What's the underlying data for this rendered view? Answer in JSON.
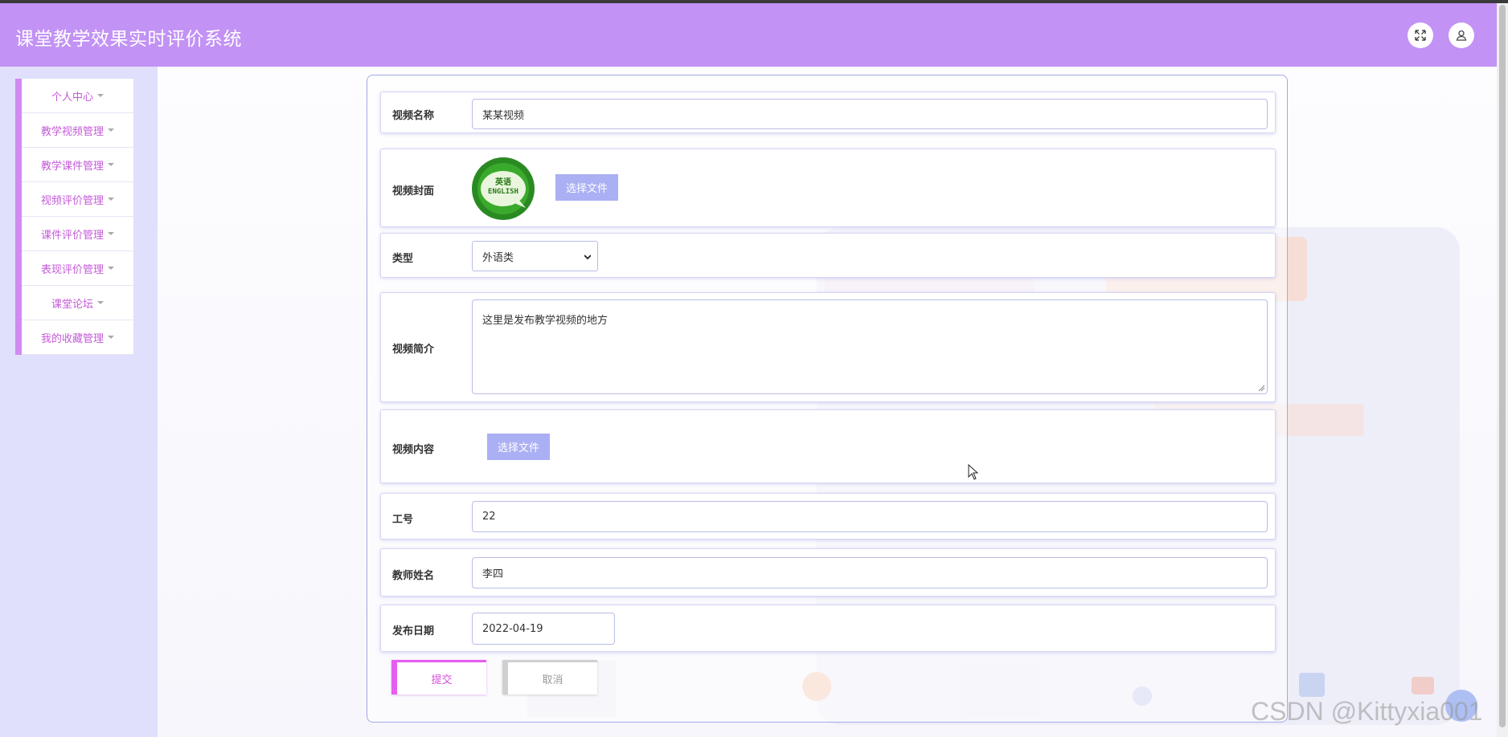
{
  "app": {
    "title": "课堂教学效果实时评价系统"
  },
  "sidebar": {
    "items": [
      {
        "label": "个人中心"
      },
      {
        "label": "教学视频管理"
      },
      {
        "label": "教学课件管理"
      },
      {
        "label": "视频评价管理"
      },
      {
        "label": "课件评价管理"
      },
      {
        "label": "表现评价管理"
      },
      {
        "label": "课堂论坛"
      },
      {
        "label": "我的收藏管理"
      }
    ]
  },
  "form": {
    "video_name": {
      "label": "视频名称",
      "value": "某某视频"
    },
    "video_cover": {
      "label": "视频封面",
      "button": "选择文件",
      "logo_text_top": "英语",
      "logo_text_bottom": "ENGLISH"
    },
    "type": {
      "label": "类型",
      "value": "外语类"
    },
    "intro": {
      "label": "视频简介",
      "value": "这里是发布教学视频的地方"
    },
    "content": {
      "label": "视频内容",
      "button": "选择文件"
    },
    "job_no": {
      "label": "工号",
      "value": "22"
    },
    "teacher_name": {
      "label": "教师姓名",
      "value": "李四"
    },
    "publish_date": {
      "label": "发布日期",
      "value": "2022-04-19"
    },
    "submit_label": "提交",
    "cancel_label": "取消"
  },
  "watermark": "CSDN @Kittyxia001",
  "colors": {
    "header": "#c292f5",
    "sidebar_bg": "#e0e0fc",
    "menu_text": "#c45ad8",
    "file_button": "#abaff3",
    "panel_border": "#a3a8e8"
  }
}
